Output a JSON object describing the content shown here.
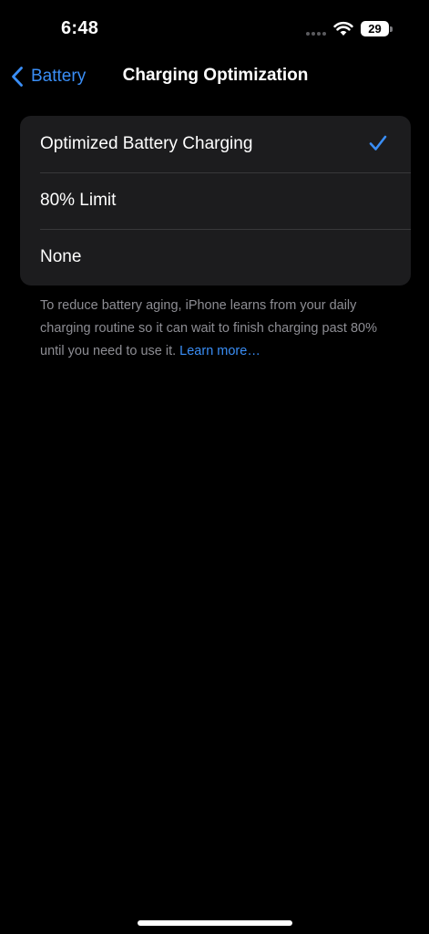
{
  "status_bar": {
    "time": "6:48",
    "battery_percent": "29",
    "battery_level_fraction": 0.29
  },
  "nav": {
    "back_label": "Battery",
    "title": "Charging Optimization"
  },
  "options": [
    {
      "label": "Optimized Battery Charging",
      "selected": true
    },
    {
      "label": "80% Limit",
      "selected": false
    },
    {
      "label": "None",
      "selected": false
    }
  ],
  "footer": {
    "description": "To reduce battery aging, iPhone learns from your daily charging routine so it can wait to finish charging past 80% until you need to use it.",
    "link_label": "Learn more…"
  },
  "colors": {
    "accent": "#3a8ef6",
    "background": "#000000",
    "group_background": "#1c1c1e",
    "secondary_text": "#8d8d93",
    "separator": "#38383a"
  },
  "icons": {
    "back": "chevron-left-icon",
    "selected": "checkmark-icon",
    "wifi": "wifi-icon",
    "battery": "battery-icon",
    "signal": "signal-dots-icon"
  }
}
